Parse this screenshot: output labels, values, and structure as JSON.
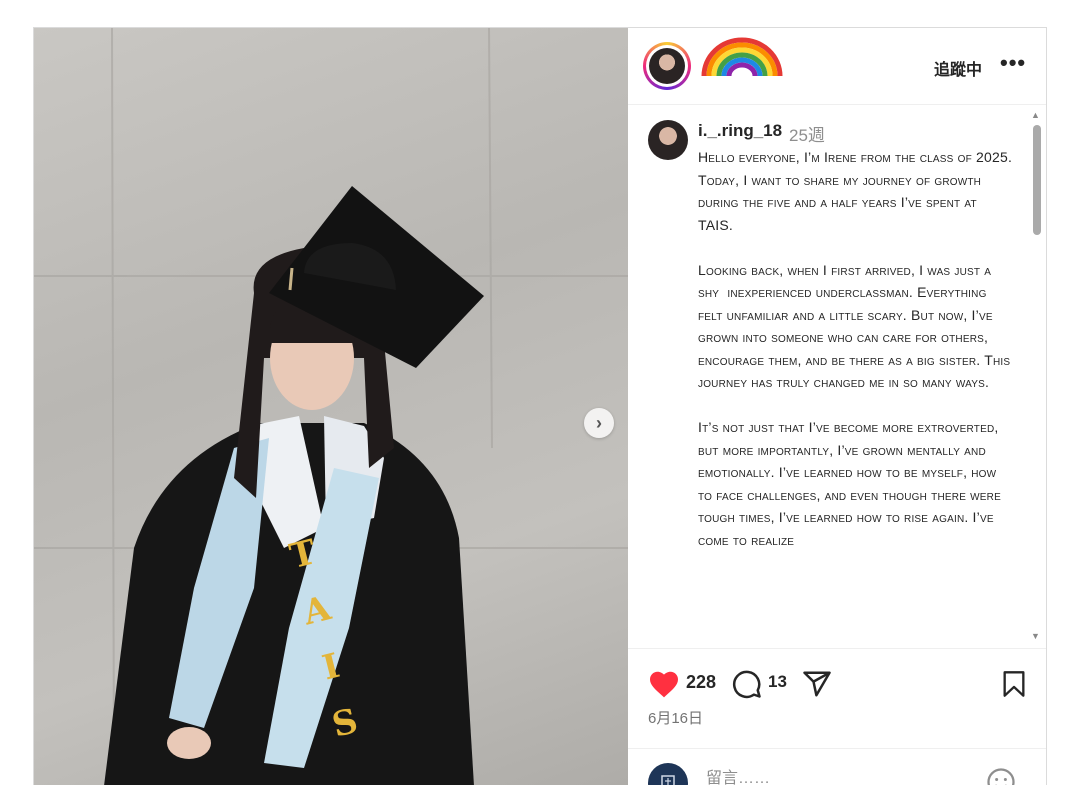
{
  "post": {
    "photo_alt": "graduation portrait",
    "stole_letters": [
      "T",
      "A",
      "I",
      "S"
    ]
  },
  "header": {
    "follow_label": "追蹤中",
    "more_label": "•••"
  },
  "caption": {
    "username": "i._.ring_18",
    "time_ago": "25週",
    "text": "Hello everyone, I’m Irene from the class of 2025.\nToday, I want to share my journey of growth during the five and a half years I’ve spent at TAIS.\n\nLooking back, when I first arrived, I was just a shy  inexperienced underclassman. Everything felt unfamiliar and a little scary. But now, I’ve grown into someone who can care for others, encourage them, and be there as a big sister. This journey has truly changed me in so many ways.\n\nIt’s not just that I’ve become more extroverted, but more importantly, I’ve grown mentally and emotionally. I’ve learned how to be myself, how to face challenges, and even though there were tough times, I’ve learned how to rise again. I’ve come to realize"
  },
  "actions": {
    "like_count": "228",
    "comment_count": "13",
    "date": "6月16日"
  },
  "comment_box": {
    "placeholder": "留言……"
  },
  "colors": {
    "heart": "#ff3040",
    "text": "#262626",
    "muted": "#8e8e8e",
    "border": "#dbdbdb"
  }
}
